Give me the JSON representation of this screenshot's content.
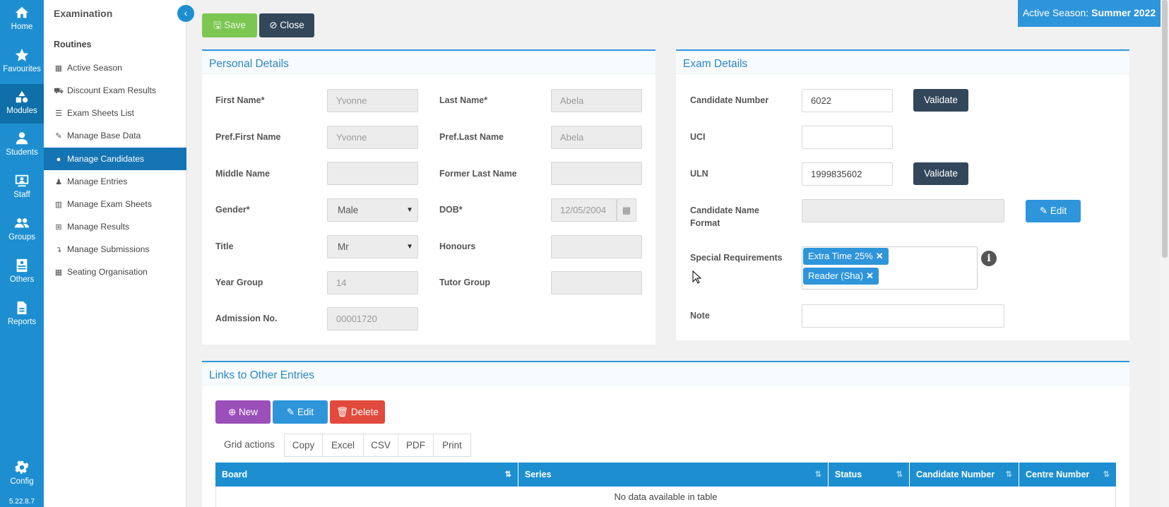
{
  "rail": {
    "items": [
      {
        "label": "Home",
        "icon": "home-icon"
      },
      {
        "label": "Favourites",
        "icon": "star-icon"
      },
      {
        "label": "Modules",
        "icon": "shapes-icon"
      },
      {
        "label": "Students",
        "icon": "user-icon"
      },
      {
        "label": "Staff",
        "icon": "presentation-icon"
      },
      {
        "label": "Groups",
        "icon": "users-icon"
      },
      {
        "label": "Others",
        "icon": "id-card-icon"
      },
      {
        "label": "Reports",
        "icon": "document-icon"
      }
    ],
    "config": "Config",
    "version": "5.22.8.7"
  },
  "sidebar": {
    "title": "Examination",
    "section": "Routines",
    "items": [
      {
        "label": "Active Season",
        "icon": "calendar-icon"
      },
      {
        "label": "Discount Exam Results",
        "icon": "cart-icon"
      },
      {
        "label": "Exam Sheets List",
        "icon": "list-icon"
      },
      {
        "label": "Manage Base Data",
        "icon": "edit-icon"
      },
      {
        "label": "Manage Candidates",
        "icon": "user-edit-icon",
        "active": true
      },
      {
        "label": "Manage Entries",
        "icon": "person-icon"
      },
      {
        "label": "Manage Exam Sheets",
        "icon": "map-icon"
      },
      {
        "label": "Manage Results",
        "icon": "plus-square-icon"
      },
      {
        "label": "Manage Submissions",
        "icon": "level-down-icon"
      },
      {
        "label": "Seating Organisation",
        "icon": "grid-icon"
      }
    ]
  },
  "toolbar": {
    "save_label": "Save",
    "close_label": "Close"
  },
  "season": {
    "prefix": "Active Season:",
    "value": "Summer 2022"
  },
  "personal": {
    "title": "Personal Details",
    "first_name_label": "First Name*",
    "first_name": "Yvonne",
    "last_name_label": "Last Name*",
    "last_name": "Abela",
    "pref_first_label": "Pref.First Name",
    "pref_first": "Yvonne",
    "pref_last_label": "Pref.Last Name",
    "pref_last": "Abela",
    "middle_label": "Middle Name",
    "middle": "",
    "former_label": "Former Last Name",
    "former": "",
    "gender_label": "Gender*",
    "gender": "Male",
    "dob_label": "DOB*",
    "dob": "12/05/2004",
    "title_label": "Title",
    "title_value": "Mr",
    "honours_label": "Honours",
    "honours": "",
    "year_group_label": "Year Group",
    "year_group": "14",
    "tutor_group_label": "Tutor Group",
    "tutor_group": "",
    "admission_label": "Admission No.",
    "admission": "00001720"
  },
  "exam": {
    "title": "Exam Details",
    "candidate_number_label": "Candidate Number",
    "candidate_number": "6022",
    "validate_label": "Validate",
    "uci_label": "UCI",
    "uci": "",
    "uln_label": "ULN",
    "uln": "1999835602",
    "name_format_label_1": "Candidate Name",
    "name_format_label_2": "Format",
    "name_format": "",
    "edit_label": "Edit",
    "special_label": "Special Requirements",
    "special_tags": [
      "Extra Time 25%",
      "Reader (Sha)"
    ],
    "note_label": "Note",
    "note": ""
  },
  "links": {
    "title": "Links to Other Entries",
    "new_label": "New",
    "edit_label": "Edit",
    "delete_label": "Delete",
    "grid_actions": "Grid actions",
    "grid_buttons": [
      "Copy",
      "Excel",
      "CSV",
      "PDF",
      "Print"
    ],
    "columns": [
      "Board",
      "Series",
      "Status",
      "Candidate Number",
      "Centre Number"
    ],
    "empty": "No data available in table"
  }
}
